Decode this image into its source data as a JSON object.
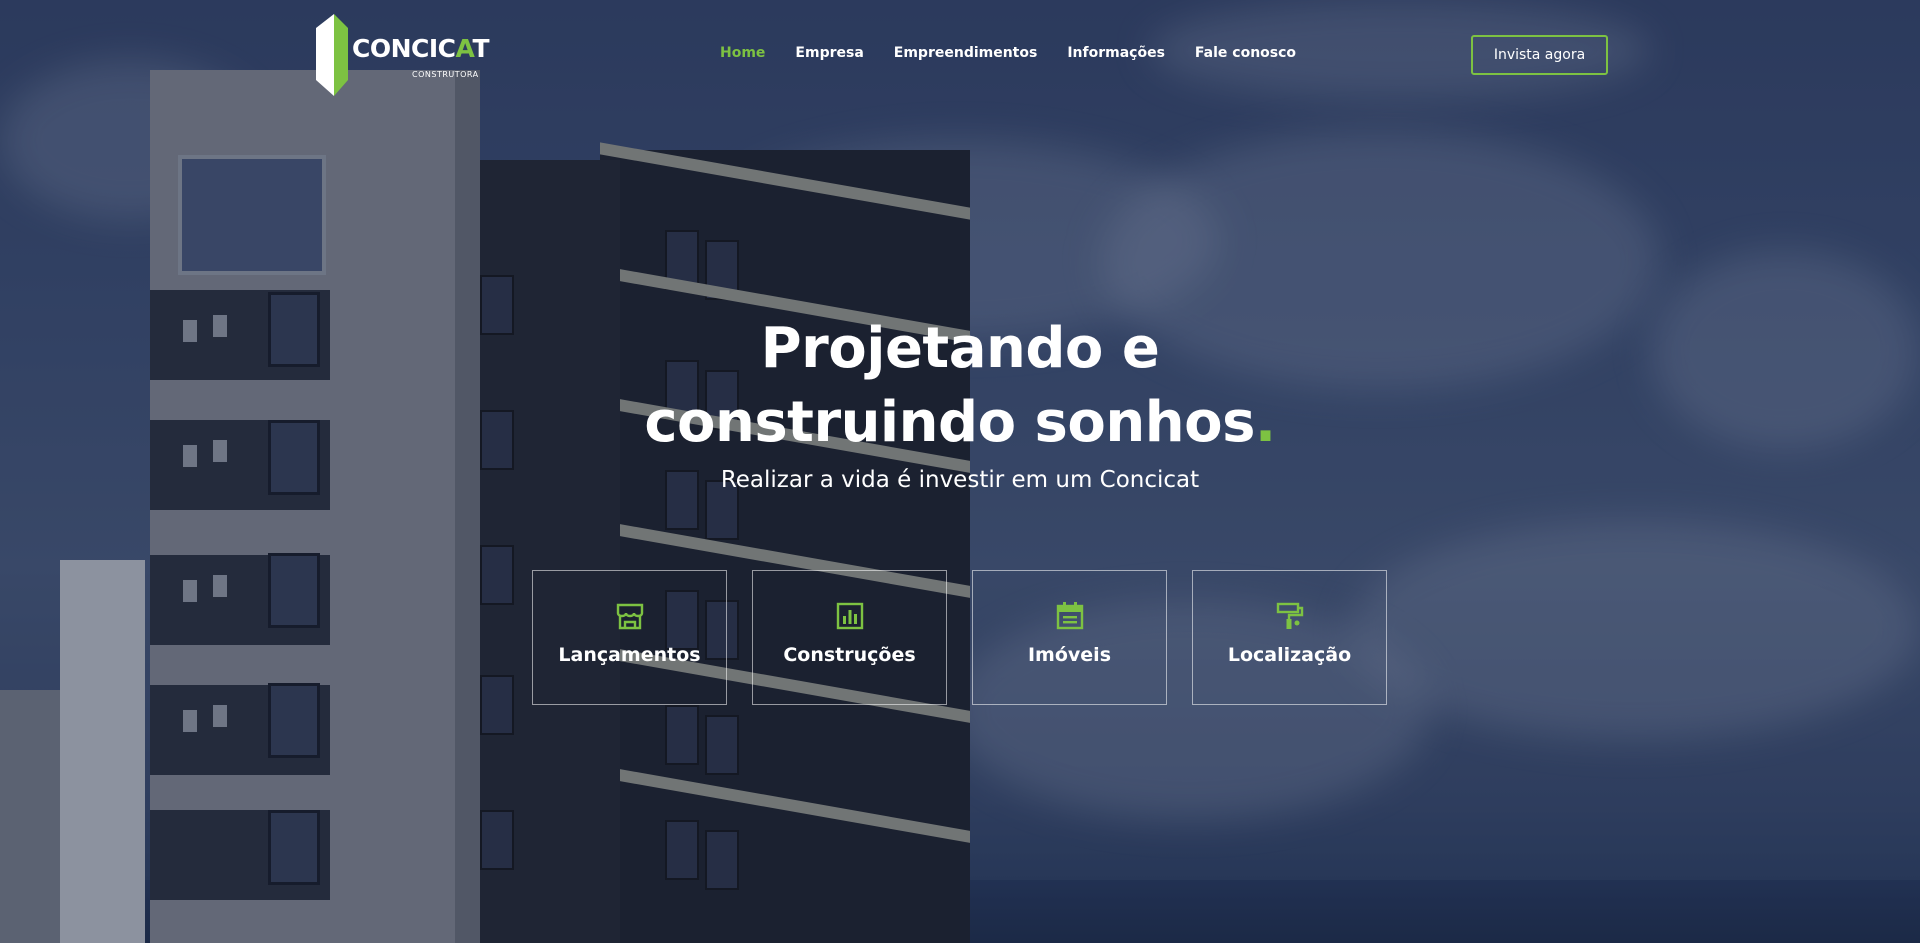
{
  "brand": {
    "name_main": "CONCIC",
    "name_accent": "A",
    "name_end": "T",
    "tagline": "CONSTRUTORA",
    "accent_color": "#7dc242"
  },
  "nav": {
    "items": [
      {
        "label": "Home",
        "active": true
      },
      {
        "label": "Empresa"
      },
      {
        "label": "Empreendimentos"
      },
      {
        "label": "Informações"
      },
      {
        "label": "Fale conosco"
      }
    ],
    "cta_label": "Invista agora"
  },
  "hero": {
    "title_line1": "Projetando e",
    "title_line2": "construindo sonhos",
    "title_dot": ".",
    "subtitle": "Realizar a vida é investir em um Concicat"
  },
  "cards": [
    {
      "label": "Lançamentos",
      "icon": "storefront-icon"
    },
    {
      "label": "Construções",
      "icon": "bar-chart-icon"
    },
    {
      "label": "Imóveis",
      "icon": "calendar-icon"
    },
    {
      "label": "Localização",
      "icon": "paint-roller-icon"
    }
  ]
}
